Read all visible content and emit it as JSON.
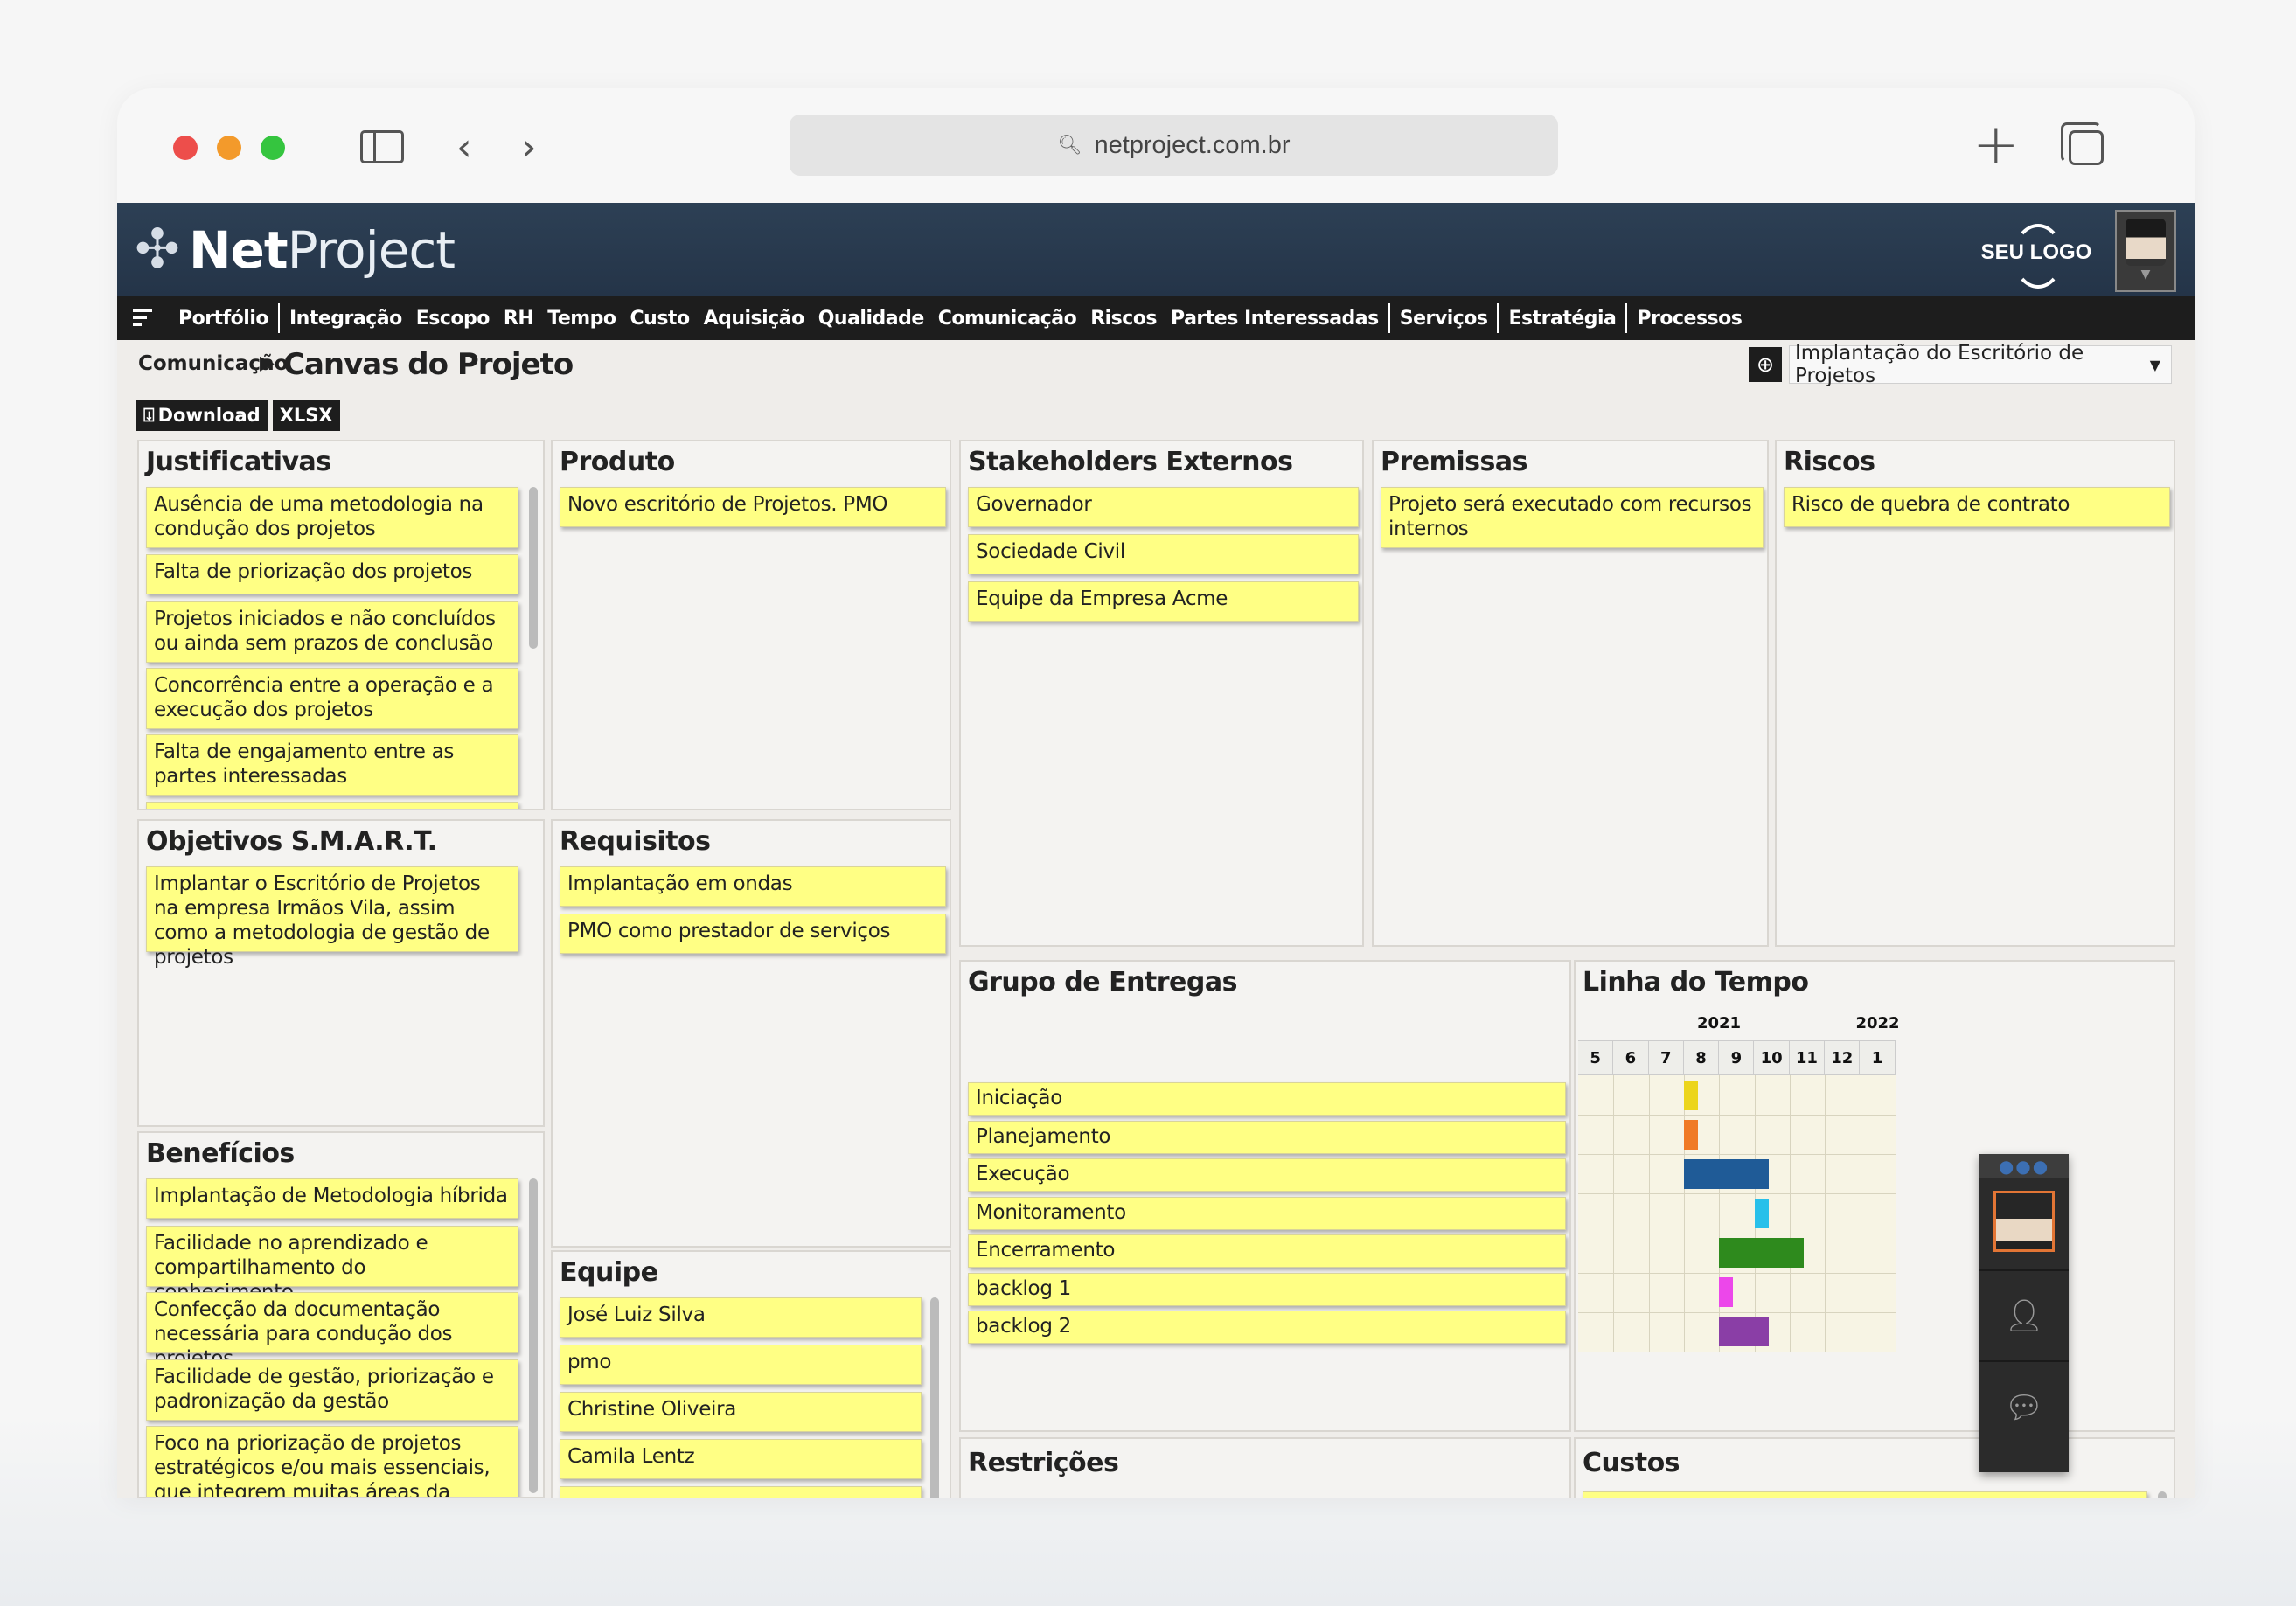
{
  "browser": {
    "url": "netproject.com.br"
  },
  "app": {
    "logo_net": "Net",
    "logo_project": "Project",
    "brand_logo_text": "SEU LOGO",
    "menu": [
      {
        "label": "Portfólio"
      },
      {
        "label": "Integração"
      },
      {
        "label": "Escopo"
      },
      {
        "label": "RH"
      },
      {
        "label": "Tempo"
      },
      {
        "label": "Custo"
      },
      {
        "label": "Aquisição"
      },
      {
        "label": "Qualidade"
      },
      {
        "label": "Comunicação"
      },
      {
        "label": "Riscos"
      },
      {
        "label": "Partes Interessadas"
      },
      {
        "label": "Serviços"
      },
      {
        "label": "Estratégia"
      },
      {
        "label": "Processos"
      }
    ],
    "breadcrumb": {
      "parent": "Comunicação",
      "current": "Canvas do Projeto"
    },
    "project_select": "Implantação do Escritório de Projetos",
    "toolbar": {
      "download": "Download",
      "xlsx": "XLSX"
    }
  },
  "canvas": {
    "justificativas": {
      "title": "Justificativas",
      "items": [
        "Ausência de uma metodologia na condução dos projetos",
        "Falta de priorização dos projetos",
        "Projetos iniciados e não concluídos ou ainda sem prazos de conclusão",
        "Concorrência entre a operação e a execução dos projetos",
        "Falta de engajamento entre as partes interessadas"
      ]
    },
    "produto": {
      "title": "Produto",
      "items": [
        "Novo escritório de Projetos. PMO"
      ]
    },
    "stakeholders": {
      "title": "Stakeholders Externos",
      "items": [
        "Governador",
        "Sociedade Civil",
        "Equipe da Empresa Acme"
      ]
    },
    "premissas": {
      "title": "Premissas",
      "items": [
        "Projeto será executado com recursos internos"
      ]
    },
    "riscos": {
      "title": "Riscos",
      "items": [
        "Risco de quebra de contrato"
      ]
    },
    "objetivos": {
      "title": "Objetivos S.M.A.R.T.",
      "items": [
        "Implantar o Escritório de Projetos na empresa Irmãos Vila, assim como a metodologia de gestão de projetos"
      ]
    },
    "requisitos": {
      "title": "Requisitos",
      "items": [
        "Implantação em ondas",
        "PMO como prestador de serviços"
      ]
    },
    "grupo_entregas": {
      "title": "Grupo de Entregas",
      "items": [
        "Iniciação",
        "Planejamento",
        "Execução",
        "Monitoramento",
        "Encerramento",
        "backlog 1",
        "backlog 2"
      ]
    },
    "linha_tempo": {
      "title": "Linha do Tempo",
      "years": [
        "2021",
        "2022"
      ],
      "months": [
        "5",
        "6",
        "7",
        "8",
        "9",
        "10",
        "11",
        "12",
        "1"
      ],
      "bars": [
        {
          "name": "Iniciação",
          "start": 3.0,
          "end": 3.4,
          "color": "#ecd51c"
        },
        {
          "name": "Planejamento",
          "start": 3.0,
          "end": 3.4,
          "color": "#f07a25"
        },
        {
          "name": "Execução",
          "start": 3.0,
          "end": 5.4,
          "color": "#1f5b97"
        },
        {
          "name": "Monitoramento",
          "start": 5.0,
          "end": 5.4,
          "color": "#28c0ea"
        },
        {
          "name": "Encerramento",
          "start": 4.0,
          "end": 6.4,
          "color": "#2e8a1d"
        },
        {
          "name": "backlog 1",
          "start": 4.0,
          "end": 4.4,
          "color": "#ec47ea"
        },
        {
          "name": "backlog 2",
          "start": 4.0,
          "end": 5.4,
          "color": "#8a3ea6"
        }
      ]
    },
    "beneficios": {
      "title": "Benefícios",
      "items": [
        "Implantação de Metodologia híbrida",
        "Facilidade no aprendizado e compartilhamento do conhecimento",
        "Confecção da documentação necessária para condução dos projetos",
        "Facilidade de gestão, priorização e padronização da gestão",
        "Foco na priorização de projetos estratégicos e/ou mais essenciais, que integrem muitas áreas da empresa"
      ]
    },
    "equipe": {
      "title": "Equipe",
      "items": [
        "José Luiz Silva",
        "pmo",
        "Christine Oliveira",
        "Camila Lentz"
      ]
    },
    "restricoes": {
      "title": "Restrições"
    },
    "custos": {
      "title": "Custos"
    }
  },
  "colors": {
    "note_yellow": "#ffff84",
    "header_navy": "#2a3b50",
    "menubar_black": "#1d1d1d"
  }
}
